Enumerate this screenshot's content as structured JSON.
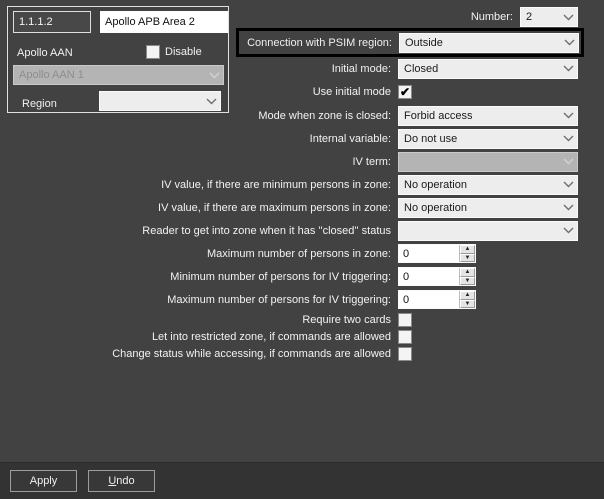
{
  "titlebox": {
    "id": "1.1.1.2",
    "name": "Apollo APB Area 2",
    "aan_label": "Apollo AAN",
    "disable_label": "Disable",
    "aan_selected": "Apollo AAN 1",
    "region_label": "Region",
    "region_selected": ""
  },
  "header": {
    "number_label": "Number:",
    "number_value": "2"
  },
  "form": {
    "connection": {
      "label": "Connection with PSIM region:",
      "value": "Outside"
    },
    "initial_mode": {
      "label": "Initial mode:",
      "value": "Closed"
    },
    "use_initial_mode": {
      "label": "Use initial mode",
      "checked": true
    },
    "mode_zone_closed": {
      "label": "Mode when zone is closed:",
      "value": "Forbid access"
    },
    "internal_variable": {
      "label": "Internal variable:",
      "value": "Do not use"
    },
    "iv_term": {
      "label": "IV term:",
      "value": ""
    },
    "iv_value_min": {
      "label": "IV value, if there are minimum persons in zone:",
      "value": "No operation"
    },
    "iv_value_max": {
      "label": "IV value, if there are maximum persons in zone:",
      "value": "No operation"
    },
    "reader_closed": {
      "label": "Reader to get into zone when it has ''closed'' status",
      "value": ""
    },
    "max_persons_zone": {
      "label": "Maximum number of persons in zone:",
      "value": "0"
    },
    "min_persons_iv": {
      "label": "Minimum number of persons for IV triggering:",
      "value": "0"
    },
    "max_persons_iv": {
      "label": "Maximum number of persons for IV triggering:",
      "value": "0"
    },
    "require_two_cards": {
      "label": "Require two cards",
      "checked": false
    },
    "let_into_restricted": {
      "label": "Let into restricted zone, if commands are allowed",
      "checked": false
    },
    "change_status": {
      "label": "Change status while accessing, if commands are allowed",
      "checked": false
    }
  },
  "footer": {
    "apply_label": "Apply",
    "undo_mnemonic": "U",
    "undo_rest": "ndo"
  },
  "icons": {
    "checkmark": "✔",
    "spinner_up": "▲",
    "spinner_down": "▼"
  },
  "colors": {
    "background": "#424242",
    "footer_bar": "#333333",
    "highlight_border": "#000000",
    "control_bg": "#ededed",
    "disabled_control_bg": "#b4b4b4",
    "field_bg": "#ffffff"
  }
}
